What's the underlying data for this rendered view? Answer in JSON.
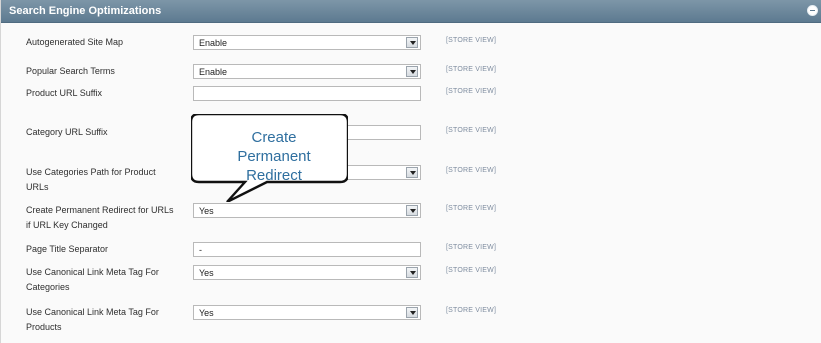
{
  "section": {
    "title": "Search Engine Optimizations",
    "collapse_icon": "collapse-icon"
  },
  "rows": [
    {
      "label": "Autogenerated Site Map",
      "value": "Enable",
      "scope": "[STORE VIEW]"
    },
    {
      "label": "Popular Search Terms",
      "value": "Enable",
      "scope": "[STORE VIEW]"
    },
    {
      "label": "Product URL Suffix",
      "value": "",
      "scope": "[STORE VIEW]"
    },
    {
      "label": "Category URL Suffix",
      "value": "",
      "scope": "[STORE VIEW]"
    },
    {
      "label": "Use Categories Path for Product URLs",
      "value": "",
      "scope": "[STORE VIEW]"
    },
    {
      "label": "Create Permanent Redirect for URLs if URL Key Changed",
      "value": "Yes",
      "scope": "[STORE VIEW]"
    },
    {
      "label": "Page Title Separator",
      "value": "-",
      "scope": "[STORE VIEW]"
    },
    {
      "label": "Use Canonical Link Meta Tag For Categories",
      "value": "Yes",
      "scope": "[STORE VIEW]"
    },
    {
      "label": "Use Canonical Link Meta Tag For Products",
      "value": "Yes",
      "scope": "[STORE VIEW]"
    }
  ],
  "callout": {
    "text_line1": "Create",
    "text_line2": "Permanent",
    "text_line3": "Redirect"
  }
}
